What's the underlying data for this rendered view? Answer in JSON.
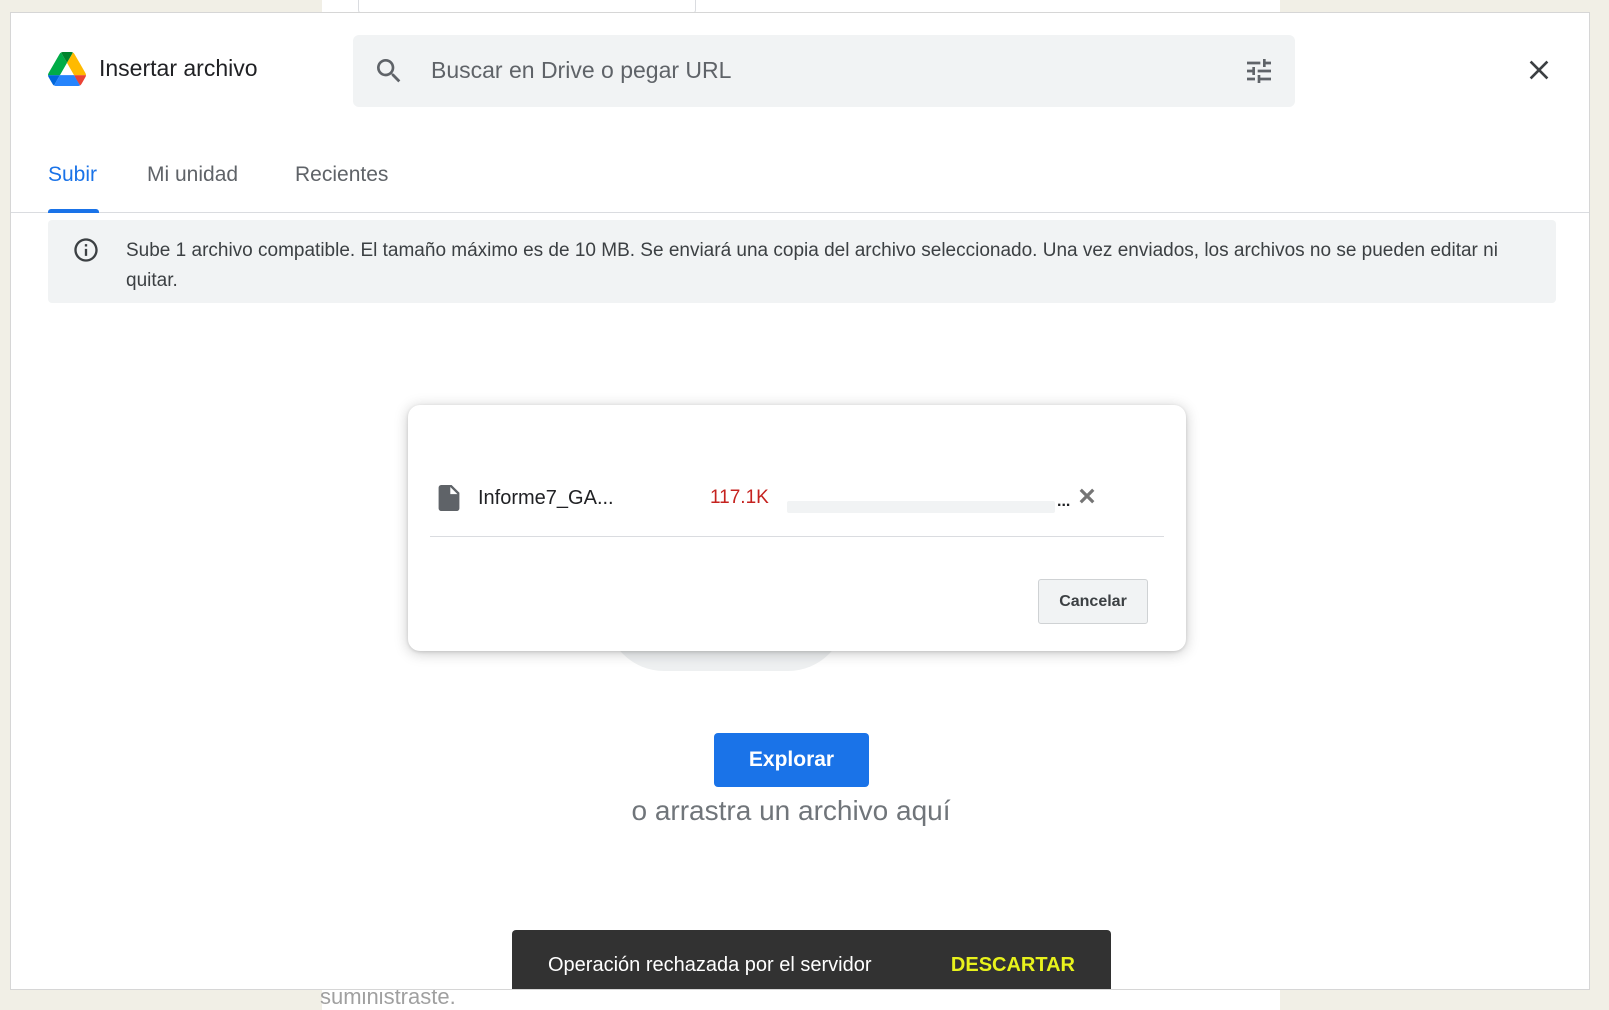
{
  "dialog": {
    "title": "Insertar archivo",
    "close_icon": "close-icon",
    "logo_icon": "google-drive-logo"
  },
  "search": {
    "placeholder": "Buscar en Drive o pegar URL",
    "search_icon": "search-icon",
    "filter_icon": "tune-icon"
  },
  "tabs": [
    {
      "label": "Subir",
      "active": true
    },
    {
      "label": "Mi unidad",
      "active": false
    },
    {
      "label": "Recientes",
      "active": false
    }
  ],
  "info": {
    "icon": "info-icon",
    "text": "Sube 1 archivo compatible. El tamaño máximo es de 10 MB. Se enviará una copia del archivo seleccionado. Una vez enviados, los archivos no se pueden editar ni quitar."
  },
  "upload": {
    "file_icon": "file-icon",
    "file_name": "Informe7_GA...",
    "file_size": "117.1K",
    "progress_fraction": 0,
    "ellipsis": "...",
    "remove_icon": "remove-icon",
    "cancel_label": "Cancelar"
  },
  "drop_area": {
    "browse_label": "Explorar",
    "drag_text": "o arrastra un archivo aquí"
  },
  "snackbar": {
    "message": "Operación rechazada por el servidor",
    "action": "DESCARTAR"
  },
  "background": {
    "text": "suministraste."
  },
  "colors": {
    "accent": "#1a73e8",
    "error": "#c5221f",
    "snackbar_bg": "#323232",
    "snackbar_action": "#e8f21c"
  }
}
